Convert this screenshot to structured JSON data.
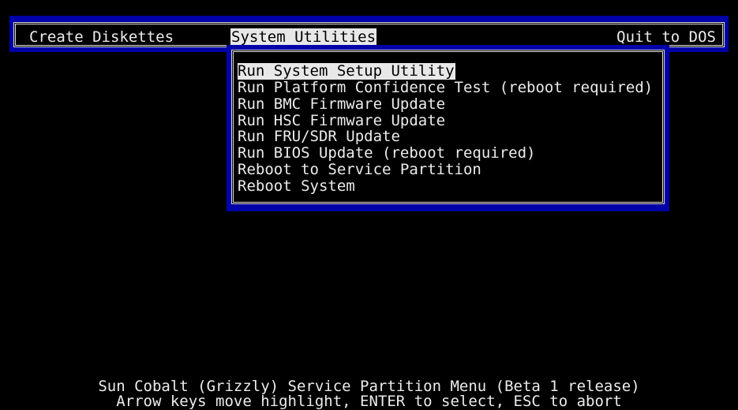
{
  "menu": {
    "items": [
      {
        "label": "Create Diskettes"
      },
      {
        "label": "System Utilities",
        "selected": true
      },
      {
        "label": "Quit to DOS"
      }
    ]
  },
  "dropdown": {
    "items": [
      {
        "label": "Run System Setup Utility",
        "selected": true
      },
      {
        "label": "Run Platform Confidence Test (reboot required)"
      },
      {
        "label": "Run BMC Firmware Update"
      },
      {
        "label": "Run HSC Firmware Update"
      },
      {
        "label": "Run FRU/SDR Update"
      },
      {
        "label": "Run BIOS Update (reboot required)"
      },
      {
        "label": "Reboot to Service Partition"
      },
      {
        "label": "Reboot System"
      }
    ]
  },
  "footer": {
    "line1": "Sun Cobalt (Grizzly) Service Partition Menu (Beta 1 release)",
    "line2": "Arrow keys move highlight, ENTER to select, ESC to abort"
  },
  "colors": {
    "background": "#000000",
    "frame_blue": "#0000a8",
    "text": "#ececec",
    "highlight_bg": "#e8e8e8",
    "highlight_fg": "#000000"
  }
}
